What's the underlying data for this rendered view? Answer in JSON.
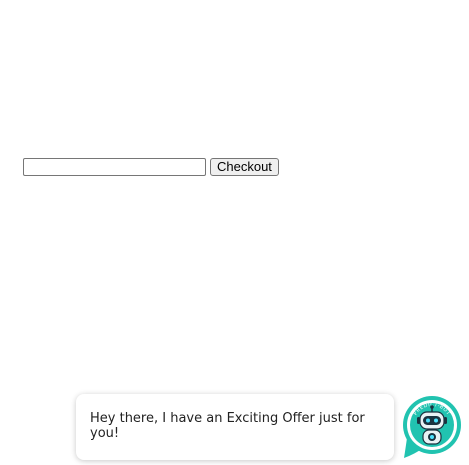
{
  "checkout": {
    "input_value": "",
    "button_label": "Checkout"
  },
  "chat": {
    "message": "Hey there, I have an Exciting Offer just for you!"
  },
  "bot": {
    "icon": "chatbot-robot-icon",
    "badge_text": "PREDICT-BOT",
    "accent_color": "#21c3b0"
  }
}
